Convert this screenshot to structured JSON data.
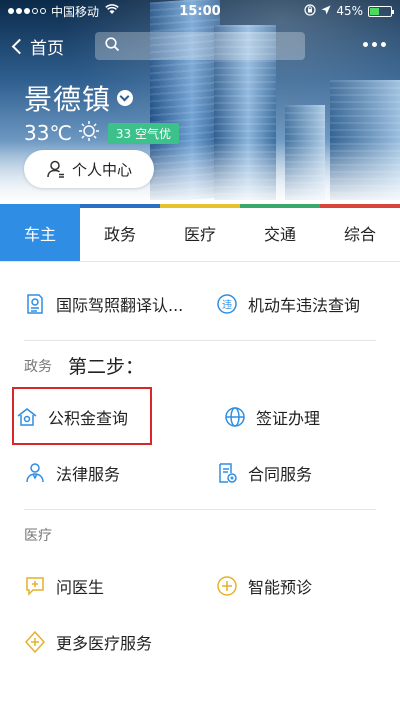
{
  "status_bar": {
    "carrier": "中国移动",
    "time": "15:00",
    "battery": "45%",
    "battery_level": 0.45
  },
  "nav": {
    "back_label": "首页",
    "search_placeholder": ""
  },
  "city": {
    "name": "景德镇",
    "temperature": "33℃",
    "aqi": "33 空气优"
  },
  "profile": {
    "label": "个人中心"
  },
  "tabs": [
    {
      "label": "车主",
      "active": true
    },
    {
      "label": "政务"
    },
    {
      "label": "医疗"
    },
    {
      "label": "交通"
    },
    {
      "label": "综合"
    }
  ],
  "sections": {
    "car": {
      "items": [
        {
          "label": "国际驾照翻译认...",
          "icon": "document-license-icon"
        },
        {
          "label": "机动车违法查询",
          "icon": "violation-icon"
        }
      ]
    },
    "gov": {
      "title": "政务",
      "annotation": "第二步：",
      "items": [
        {
          "label": "公积金查询",
          "icon": "house-fund-icon"
        },
        {
          "label": "签证办理",
          "icon": "globe-icon"
        },
        {
          "label": "法律服务",
          "icon": "lawyer-icon"
        },
        {
          "label": "合同服务",
          "icon": "contract-icon"
        }
      ]
    },
    "medical": {
      "title": "医疗",
      "items": [
        {
          "label": "问医生",
          "icon": "ask-doctor-icon"
        },
        {
          "label": "智能预诊",
          "icon": "smart-diagnosis-icon"
        },
        {
          "label": "更多医疗服务",
          "icon": "medical-cross-icon"
        }
      ]
    }
  },
  "colors": {
    "accent": "#2f8ee3",
    "highlight": "#d9262b",
    "aqi": "#3cc18a"
  }
}
